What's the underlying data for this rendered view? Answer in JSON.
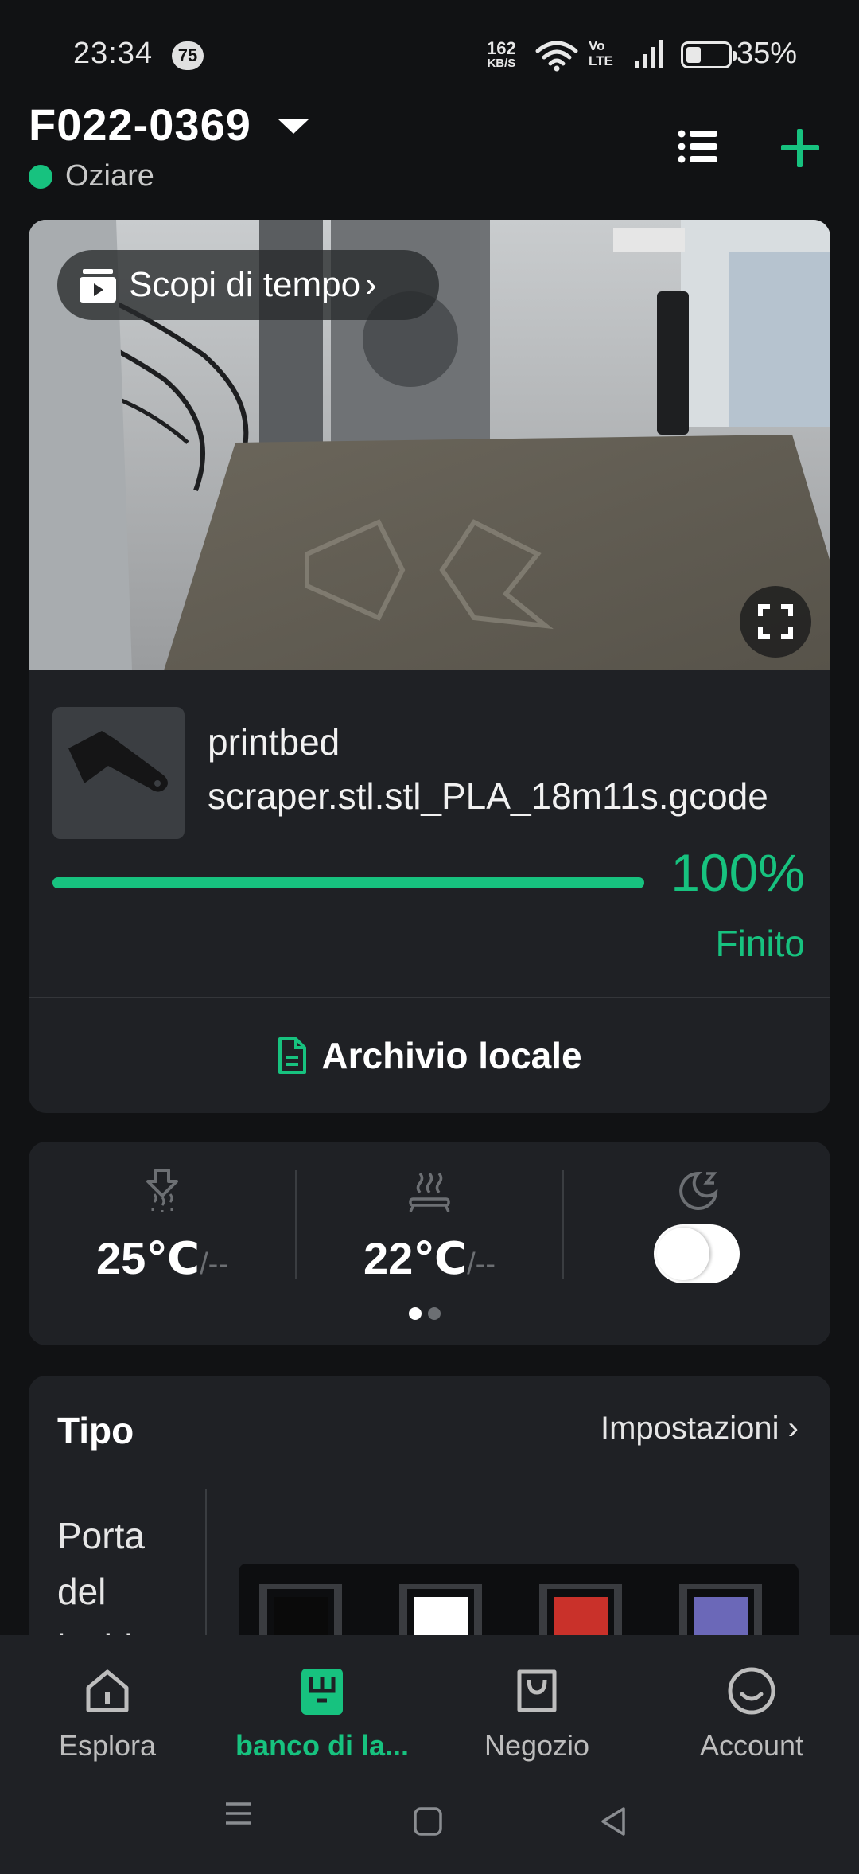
{
  "status_bar": {
    "time": "23:34",
    "notification_count": "75",
    "net_speed_value": "162",
    "net_speed_unit": "KB/S",
    "volte_line1": "Vo",
    "volte_line2": "LTE",
    "battery_percent": "35%",
    "battery_level": 0.35
  },
  "header": {
    "device_name": "F022-0369",
    "status": "Oziare",
    "status_color": "#17c27f"
  },
  "camera": {
    "timelapse_label": "Scopi di tempo"
  },
  "print_job": {
    "file_name": "printbed scraper.stl.stl_PLA_18m11s.gcode",
    "progress": 1.0,
    "progress_text": "100%",
    "state": "Finito",
    "archive_label": "Archivio locale"
  },
  "temperatures": {
    "nozzle_value": "25℃",
    "nozzle_target": "/--",
    "bed_value": "22℃",
    "bed_target": "/--",
    "sleep_toggle": true,
    "page_dots": 2,
    "active_dot": 0
  },
  "tipo": {
    "title": "Tipo",
    "settings_label": "Impostazioni",
    "left_label": "Porta del lucido",
    "spools": [
      "#0a0a0a",
      "#ffffff",
      "#c9312a",
      "#6b68b8"
    ]
  },
  "nav": {
    "items": [
      {
        "label": "Esplora",
        "icon": "home-icon"
      },
      {
        "label": "banco di la...",
        "icon": "workbench-icon"
      },
      {
        "label": "Negozio",
        "icon": "shop-bag-icon"
      },
      {
        "label": "Account",
        "icon": "account-icon"
      }
    ],
    "active_index": 1
  },
  "colors": {
    "accent": "#17c27f",
    "card": "#1f2125",
    "background": "#111214"
  }
}
